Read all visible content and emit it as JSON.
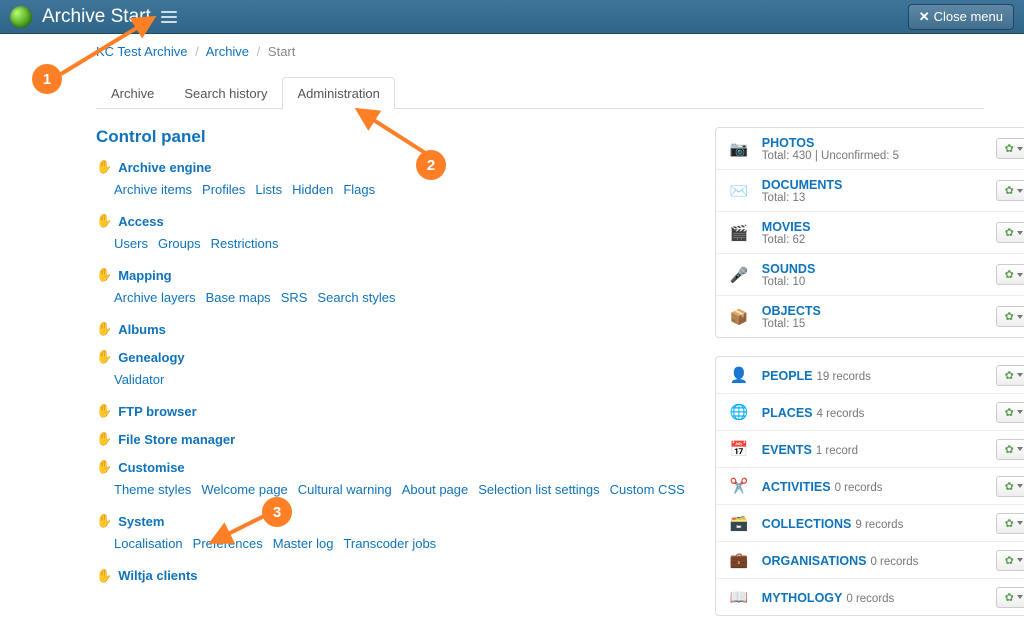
{
  "topbar": {
    "title": "Archive Start",
    "close": "Close menu"
  },
  "breadcrumb": {
    "root": "KC Test Archive",
    "mid": "Archive",
    "current": "Start"
  },
  "tabs": [
    "Archive",
    "Search history",
    "Administration"
  ],
  "active_tab": 2,
  "control_panel_heading": "Control panel",
  "sections": [
    {
      "title": "Archive engine",
      "links": [
        "Archive items",
        "Profiles",
        "Lists",
        "Hidden",
        "Flags"
      ]
    },
    {
      "title": "Access",
      "links": [
        "Users",
        "Groups",
        "Restrictions"
      ]
    },
    {
      "title": "Mapping",
      "links": [
        "Archive layers",
        "Base maps",
        "SRS",
        "Search styles"
      ]
    },
    {
      "title": "Albums",
      "links": []
    },
    {
      "title": "Genealogy",
      "links": [
        "Validator"
      ]
    },
    {
      "title": "FTP browser",
      "links": []
    },
    {
      "title": "File Store manager",
      "links": []
    },
    {
      "title": "Customise",
      "links": [
        "Theme styles",
        "Welcome page",
        "Cultural warning",
        "About page",
        "Selection list settings",
        "Custom CSS"
      ]
    },
    {
      "title": "System",
      "links": [
        "Localisation",
        "Preferences",
        "Master log",
        "Transcoder jobs"
      ]
    },
    {
      "title": "Wiltja clients",
      "links": []
    }
  ],
  "stats_top": [
    {
      "icon": "📷",
      "title": "PHOTOS",
      "sub": "Total: 430 | Unconfirmed: 5"
    },
    {
      "icon": "✉️",
      "title": "DOCUMENTS",
      "sub": "Total: 13"
    },
    {
      "icon": "🎬",
      "title": "MOVIES",
      "sub": "Total: 62"
    },
    {
      "icon": "🎤",
      "title": "SOUNDS",
      "sub": "Total: 10"
    },
    {
      "icon": "📦",
      "title": "OBJECTS",
      "sub": "Total: 15"
    }
  ],
  "stats_bottom": [
    {
      "icon": "👤",
      "title": "PEOPLE",
      "sub": "19 records"
    },
    {
      "icon": "🌐",
      "title": "PLACES",
      "sub": "4 records"
    },
    {
      "icon": "📅",
      "title": "EVENTS",
      "sub": "1 record"
    },
    {
      "icon": "✂️",
      "title": "ACTIVITIES",
      "sub": "0 records"
    },
    {
      "icon": "🗃️",
      "title": "COLLECTIONS",
      "sub": "9 records"
    },
    {
      "icon": "💼",
      "title": "ORGANISATIONS",
      "sub": "0 records"
    },
    {
      "icon": "📖",
      "title": "MYTHOLOGY",
      "sub": "0 records"
    }
  ],
  "callouts": {
    "c1": "1",
    "c2": "2",
    "c3": "3"
  }
}
